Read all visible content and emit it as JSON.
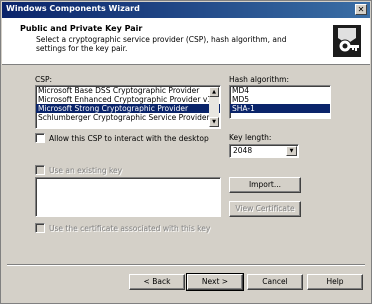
{
  "window": {
    "title": "Windows Components Wizard",
    "close_glyph": "✕"
  },
  "header": {
    "title": "Public and Private Key Pair",
    "subtitle": "Select a cryptographic service provider (CSP), hash algorithm, and settings for the key pair."
  },
  "csp": {
    "label": "CSP:",
    "items": [
      "Microsoft Base DSS Cryptographic Provider",
      "Microsoft Enhanced Cryptographic Provider v1.0",
      "Microsoft Strong Cryptographic Provider",
      "Schlumberger Cryptographic Service Provider"
    ],
    "selected_index": 2
  },
  "hash": {
    "label": "Hash algorithm:",
    "items": [
      "MD4",
      "MD5",
      "SHA-1"
    ],
    "selected_index": 2
  },
  "desktop_checkbox": {
    "label": "Allow this CSP to interact with the desktop",
    "checked": false
  },
  "key_length": {
    "label": "Key length:",
    "value": "2048"
  },
  "existing_key": {
    "label": "Use an existing key",
    "checked": false
  },
  "buttons": {
    "import": "Import...",
    "view_certificate": "View Certificate",
    "back": "< Back",
    "next": "Next >",
    "cancel": "Cancel",
    "help": "Help"
  },
  "associated_cert": {
    "label": "Use the certificate associated with this key",
    "checked": false
  }
}
